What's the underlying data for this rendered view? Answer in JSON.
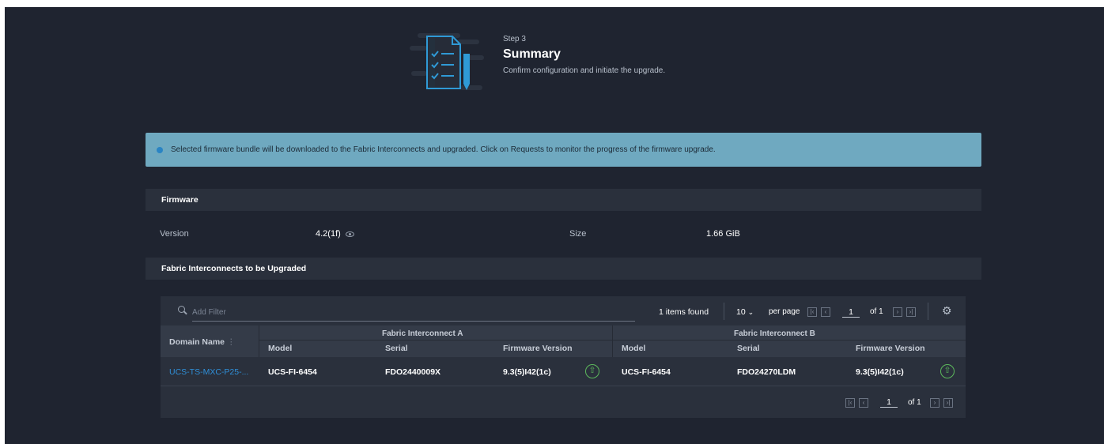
{
  "header": {
    "step_label": "Step 3",
    "title": "Summary",
    "description": "Confirm configuration and initiate the upgrade.",
    "illustration_icon": "checklist-document-icon"
  },
  "banner": {
    "icon": "info-dot-icon",
    "text": "Selected firmware bundle will be downloaded to the Fabric Interconnects and upgraded. Click on Requests to monitor the progress of the firmware upgrade."
  },
  "firmware": {
    "section_title": "Firmware",
    "version_label": "Version",
    "version_value": "4.2(1f)",
    "size_label": "Size",
    "size_value": "1.66 GiB"
  },
  "fi_section": {
    "title": "Fabric Interconnects to be Upgraded"
  },
  "table": {
    "filter_placeholder": "Add Filter",
    "items_found": "1 items found",
    "per_page_value": "10",
    "per_page_label": "per page",
    "page_current": "1",
    "page_of": "of 1",
    "group_a": "Fabric Interconnect A",
    "group_b": "Fabric Interconnect B",
    "columns": {
      "domain_name": "Domain Name",
      "model": "Model",
      "serial": "Serial",
      "firmware_version": "Firmware Version"
    },
    "rows": [
      {
        "domain_name": "UCS-TS-MXC-P25-...",
        "a_model": "UCS-FI-6454",
        "a_serial": "FDO2440009X",
        "a_firmware": "9.3(5)I42(1c)",
        "b_model": "UCS-FI-6454",
        "b_serial": "FDO24270LDM",
        "b_firmware": "9.3(5)I42(1c)"
      }
    ]
  },
  "colors": {
    "background": "#1f2430",
    "banner": "#6fa9c0",
    "link": "#2f8fd8",
    "upgrade_icon": "#5cb85c"
  }
}
